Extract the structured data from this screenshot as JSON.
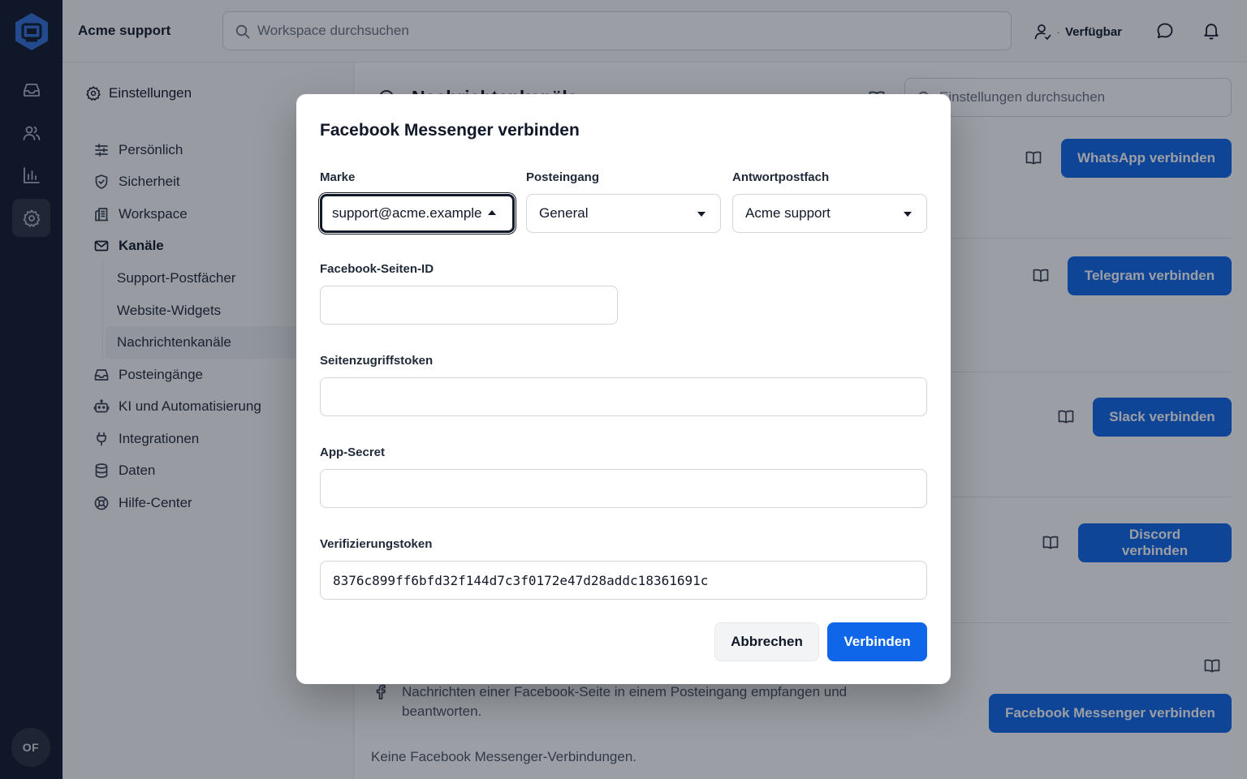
{
  "topbar": {
    "workspace_name": "Acme support",
    "search_placeholder": "Workspace durchsuchen",
    "status_separator": "·",
    "status_label": "Verfügbar"
  },
  "rail": {
    "avatar_initials": "OF",
    "nav_icons": [
      "inbox-icon",
      "users-icon",
      "chart-icon",
      "settings-icon"
    ],
    "active_item": "settings-icon"
  },
  "sidebar": {
    "title": "Einstellungen",
    "items": [
      {
        "label": "Persönlich",
        "icon": "sliders-icon"
      },
      {
        "label": "Sicherheit",
        "icon": "shield-icon"
      },
      {
        "label": "Workspace",
        "icon": "building-icon"
      },
      {
        "label": "Kanäle",
        "icon": "mail-icon"
      },
      {
        "label": "Posteingänge",
        "icon": "inbox-icon"
      },
      {
        "label": "KI und Automatisierung",
        "icon": "bot-icon"
      },
      {
        "label": "Integrationen",
        "icon": "plug-icon"
      },
      {
        "label": "Daten",
        "icon": "database-icon"
      },
      {
        "label": "Hilfe-Center",
        "icon": "lifebuoy-icon"
      }
    ],
    "subitems": [
      "Support-Postfächer",
      "Website-Widgets",
      "Nachrichtenkanäle"
    ],
    "active_subitem": "Nachrichtenkanäle"
  },
  "main": {
    "title": "Nachrichtenkanäle",
    "search_placeholder": "Einstellungen durchsuchen",
    "connect_buttons": [
      "WhatsApp verbinden",
      "Telegram verbinden",
      "Slack verbinden",
      "Discord verbinden",
      "Facebook Messenger verbinden"
    ],
    "facebook_description": "Nachrichten einer Facebook-Seite in einem Posteingang empfangen und beantworten.",
    "facebook_empty": "Keine Facebook Messenger-Verbindungen."
  },
  "modal": {
    "title": "Facebook Messenger verbinden",
    "brand_label": "Marke",
    "brand_value": "support@acme.example",
    "inbox_label": "Posteingang",
    "inbox_value": "General",
    "reply_label": "Antwortpostfach",
    "reply_value": "Acme support",
    "page_id_label": "Facebook-Seiten-ID",
    "page_id_value": "",
    "token_label": "Seitenzugriffstoken",
    "token_value": "",
    "secret_label": "App-Secret",
    "secret_value": "",
    "verify_label": "Verifizierungstoken",
    "verify_value": "8376c899ff6bfd32f144d7c3f0172e47d28addc18361691c",
    "cancel_label": "Abbrechen",
    "connect_label": "Verbinden"
  },
  "colors": {
    "accent": "#0f66e8",
    "rail_bg": "#11182a",
    "overlay": "rgba(17,24,39,0.42)"
  }
}
